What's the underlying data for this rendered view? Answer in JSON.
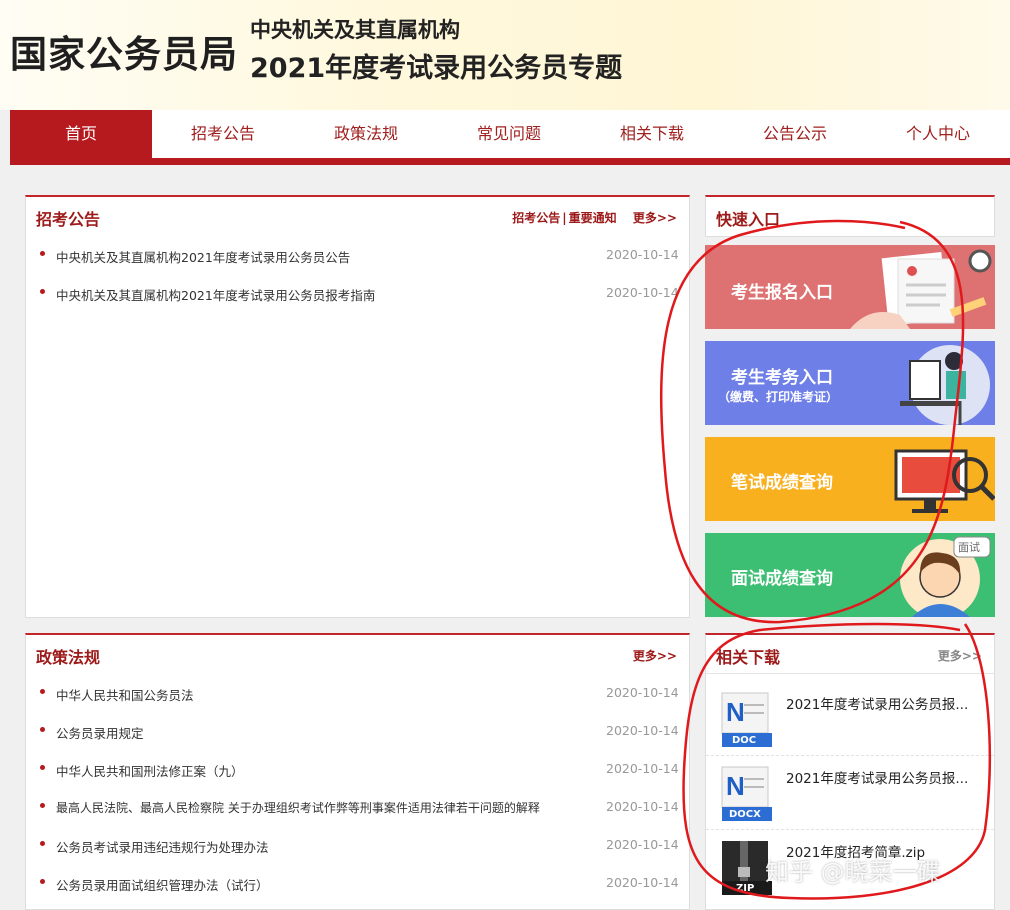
{
  "header": {
    "logo": "国家公务员局",
    "subtitle1": "中央机关及其直属机构",
    "subtitle2": "2021年度考试录用公务员专题"
  },
  "nav": [
    "首页",
    "招考公告",
    "政策法规",
    "常见问题",
    "相关下载",
    "公告公示",
    "个人中心"
  ],
  "announcements": {
    "title": "招考公告",
    "link1": "招考公告",
    "link2": "重要通知",
    "more": "更多>>",
    "items": [
      {
        "text": "中央机关及其直属机构2021年度考试录用公务员公告",
        "date": "2020-10-14"
      },
      {
        "text": "中央机关及其直属机构2021年度考试录用公务员报考指南",
        "date": "2020-10-14"
      }
    ]
  },
  "quick": {
    "title": "快速入口",
    "buttons": [
      {
        "label": "考生报名入口",
        "color": "#de7272"
      },
      {
        "label": "考生考务入口",
        "sub": "（缴费、打印准考证）",
        "color": "#6f7fe8"
      },
      {
        "label": "笔试成绩查询",
        "color": "#f8b01f"
      },
      {
        "label": "面试成绩查询",
        "badge": "面试",
        "color": "#3dbf73"
      }
    ]
  },
  "policy": {
    "title": "政策法规",
    "more": "更多>>",
    "items": [
      {
        "text": "中华人民共和国公务员法",
        "date": "2020-10-14"
      },
      {
        "text": "公务员录用规定",
        "date": "2020-10-14"
      },
      {
        "text": "中华人民共和国刑法修正案（九）",
        "date": "2020-10-14"
      },
      {
        "text": "最高人民法院、最高人民检察院 关于办理组织考试作弊等刑事案件适用法律若干问题的解释",
        "date": "2020-10-14"
      },
      {
        "text": "公务员考试录用违纪违规行为处理办法",
        "date": "2020-10-14"
      },
      {
        "text": "公务员录用面试组织管理办法（试行）",
        "date": "2020-10-14"
      }
    ]
  },
  "downloads": {
    "title": "相关下载",
    "more": "更多>>",
    "items": [
      {
        "name": "2021年度考试录用公务员报...",
        "type": "DOC"
      },
      {
        "name": "2021年度考试录用公务员报...",
        "type": "DOCX"
      },
      {
        "name": "2021年度招考简章.zip",
        "type": "ZIP"
      }
    ]
  },
  "watermark": "知乎 @晓菜一碟",
  "colors": {
    "brand_red": "#b6191e",
    "title_red": "#9d1a1a"
  }
}
